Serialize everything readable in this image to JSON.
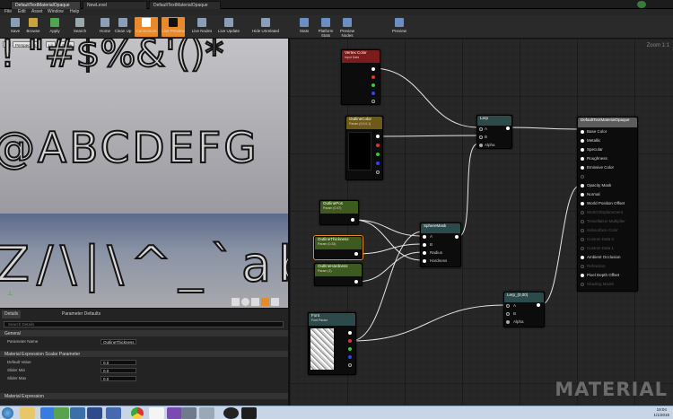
{
  "tabs": [
    {
      "label": "DefaultTextMaterialOpaque",
      "active": true
    },
    {
      "label": "NewLevel"
    },
    {
      "label": "DefaultTextMaterialOpaque"
    }
  ],
  "menus": [
    "File",
    "Edit",
    "Asset",
    "Window",
    "Help"
  ],
  "toolbar": [
    {
      "label": "Save",
      "icon": "save-icon",
      "color": "#8aa0b8"
    },
    {
      "label": "Browse",
      "icon": "browse-icon",
      "color": "#c9a43c"
    },
    {
      "label": "Apply",
      "icon": "apply-icon",
      "color": "#4ea64e"
    },
    {
      "label": "Search",
      "icon": "search-icon",
      "color": "#9aa"
    },
    {
      "label": "Home",
      "icon": "home-icon",
      "color": "#8aa0b8"
    },
    {
      "label": "Clean Up",
      "icon": "clean-up-icon",
      "color": "#8aa0b8"
    },
    {
      "label": "Connectors",
      "icon": "connectors-icon",
      "color": "#fff",
      "active": true
    },
    {
      "label": "Live Preview",
      "icon": "live-preview-icon",
      "color": "#111",
      "active": true
    },
    {
      "label": "Live Nodes",
      "icon": "live-nodes-icon",
      "color": "#8aa0b8"
    },
    {
      "label": "Live Update",
      "icon": "live-update-icon",
      "color": "#8aa0b8"
    },
    {
      "label": "Hide Unrelated",
      "icon": "hide-unrelated-icon",
      "color": "#8aa0b8"
    },
    {
      "label": "Stats",
      "icon": "stats-icon",
      "color": "#6b8fc5"
    },
    {
      "label": "Platform Stats",
      "icon": "platform-stats-icon",
      "color": "#6b8fc5"
    },
    {
      "label": "Preview Nodes",
      "icon": "preview-nodes-icon",
      "color": "#6b8fc5"
    },
    {
      "label": "Preview",
      "icon": "preview-icon",
      "color": "#6b8fc5"
    }
  ],
  "viewport": {
    "buttons": [
      "Perspective",
      "Lit",
      "Show"
    ],
    "rows": [
      "!  \"#$%&'()*",
      "@ABCDEFG",
      "Z/\\|\\^_`abc"
    ]
  },
  "details": {
    "tabs": [
      "Details",
      "Parameter Defaults"
    ],
    "search_placeholder": "Search Details",
    "sections": [
      {
        "title": "General",
        "rows": [
          {
            "label": "Parameter Name",
            "value": "OutlineThickness"
          }
        ]
      },
      {
        "title": "Material Expression Scalar Parameter",
        "rows": [
          {
            "label": "Default Value",
            "value": "0.0"
          },
          {
            "label": "Slider Min",
            "value": "0.0"
          },
          {
            "label": "Slider Max",
            "value": "0.0"
          }
        ]
      },
      {
        "title": "Material Expression",
        "rows": []
      }
    ]
  },
  "graph": {
    "zoom": "Zoom 1:1",
    "watermark": "MATERIAL",
    "nodes": {
      "vertex_color": {
        "title": "Vertex Color",
        "sub": "Input Data"
      },
      "outline_color": {
        "title": "OutlineColor",
        "sub": "Param (0,0,0,1)"
      },
      "outline_pos": {
        "title": "OutlinePos",
        "sub": "Param (0.47)"
      },
      "outline_thickness": {
        "title": "OutlineThickness",
        "sub": "Param (0.33)"
      },
      "outline_hardness": {
        "title": "OutlineHardness",
        "sub": "Param (1)"
      },
      "font": {
        "title": "Font",
        "sub": "Font Param"
      },
      "lerp": {
        "title": "Lerp",
        "pins": [
          "A",
          "B",
          "Alpha"
        ]
      },
      "sphere_mask": {
        "title": "SphereMask",
        "pins": [
          "A",
          "B",
          "Radius",
          "Hardness"
        ]
      },
      "lerp_b": {
        "title": "Lerp_(0,00)",
        "pins": [
          "A",
          "B",
          "Alpha"
        ]
      },
      "result": {
        "title": "DefaultTextMaterialOpaque",
        "pins": [
          {
            "label": "Base Color",
            "on": true
          },
          {
            "label": "Metallic",
            "on": true
          },
          {
            "label": "Specular",
            "on": true
          },
          {
            "label": "Roughness",
            "on": true
          },
          {
            "label": "Emissive Color",
            "on": true
          },
          {
            "label": "",
            "on": false
          },
          {
            "label": "Opacity Mask",
            "on": true
          },
          {
            "label": "Normal",
            "on": true
          },
          {
            "label": "World Position Offset",
            "on": true
          },
          {
            "label": "World Displacement",
            "on": false
          },
          {
            "label": "Tessellation Multiplier",
            "on": false
          },
          {
            "label": "Subsurface Color",
            "on": false
          },
          {
            "label": "Custom Data 0",
            "on": false
          },
          {
            "label": "Custom Data 1",
            "on": false
          },
          {
            "label": "Ambient Occlusion",
            "on": true
          },
          {
            "label": "Refraction",
            "on": false
          },
          {
            "label": "Pixel Depth Offset",
            "on": true
          },
          {
            "label": "Shading Model",
            "on": false
          }
        ]
      }
    }
  },
  "taskbar": {
    "time": "19:04",
    "date": "1/1/2015"
  }
}
